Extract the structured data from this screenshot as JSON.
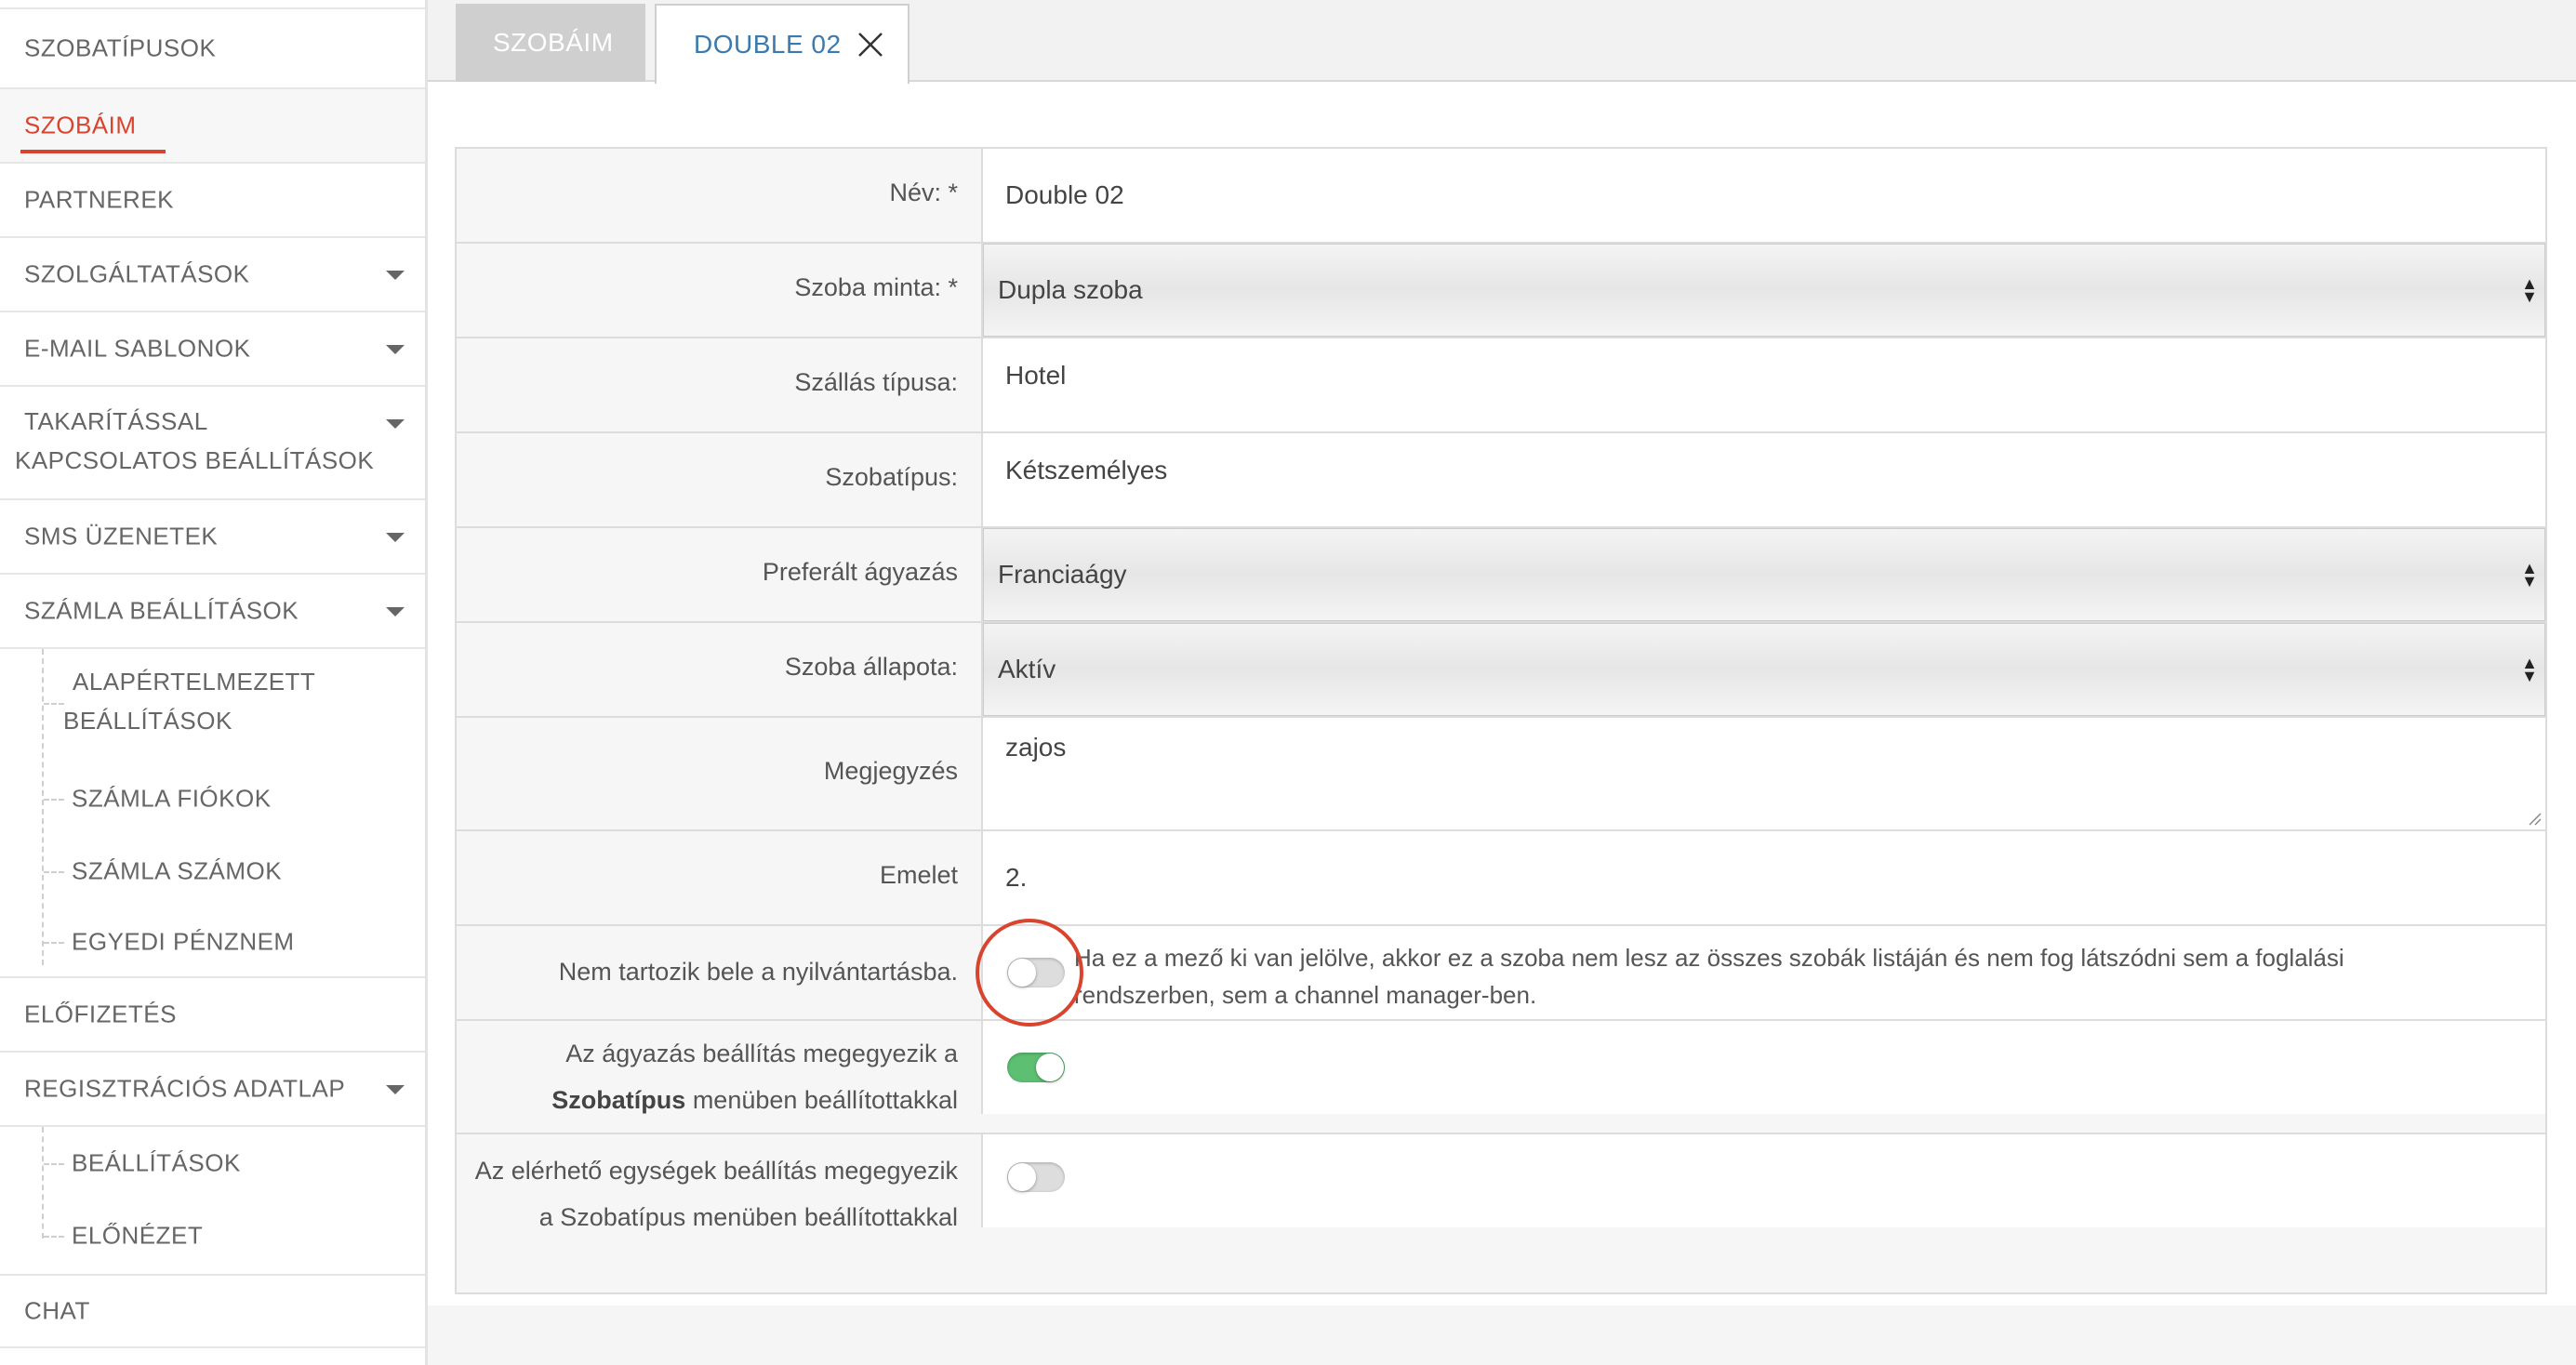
{
  "sidebar": {
    "items": [
      {
        "label": "SZOBATÍPUSOK"
      },
      {
        "label": "SZOBÁIM",
        "active": true
      },
      {
        "label": "PARTNEREK"
      },
      {
        "label": "SZOLGÁLTATÁSOK"
      },
      {
        "label": "E-MAIL SABLONOK"
      },
      {
        "label": "TAKARÍTÁSSAL KAPCSOLATOS BEÁLLÍTÁSOK"
      },
      {
        "label": "SMS ÜZENETEK"
      },
      {
        "label": "SZÁMLA BEÁLLÍTÁSOK"
      }
    ],
    "invoice_sub": [
      {
        "label": "ALAPÉRTELMEZETT BEÁLLÍTÁSOK"
      },
      {
        "label": "SZÁMLA FIÓKOK"
      },
      {
        "label": "SZÁMLA SZÁMOK"
      },
      {
        "label": "EGYEDI PÉNZNEM"
      }
    ],
    "subscription": {
      "label": "ELŐFIZETÉS"
    },
    "registration": {
      "label": "REGISZTRÁCIÓS ADATLAP"
    },
    "registration_sub": [
      {
        "label": "BEÁLLÍTÁSOK"
      },
      {
        "label": "ELŐNÉZET"
      }
    ],
    "chat": {
      "label": "CHAT"
    }
  },
  "tabs": {
    "rooms": "SZOBÁIM",
    "current": "DOUBLE 02",
    "close_icon": "close-icon"
  },
  "form": {
    "name": {
      "label": "Név: *",
      "value": "Double 02"
    },
    "room_template": {
      "label": "Szoba minta: *",
      "value": "Dupla szoba"
    },
    "accommodation_type": {
      "label": "Szállás típusa:",
      "value": "Hotel"
    },
    "room_type": {
      "label": "Szobatípus:",
      "value": "Kétszemélyes"
    },
    "preferred_bedding": {
      "label": "Preferált ágyazás",
      "value": "Franciaágy"
    },
    "room_status": {
      "label": "Szoba állapota:",
      "value": "Aktív"
    },
    "note": {
      "label": "Megjegyzés",
      "value": "zajos"
    },
    "floor": {
      "label": "Emelet",
      "value": "2."
    },
    "not_in_inventory": {
      "label": "Nem tartozik bele a nyilvántartásba.",
      "checked": false,
      "help": "Ha ez a mező ki van jelölve, akkor ez a szoba nem  lesz az összes szobák listáján és nem fog látszódni sem a foglalási rendszerben, sem a channel manager-ben."
    },
    "bedding_matches": {
      "label_pre": "Az ágyazás beállítás megegyezik a",
      "label_bold": "Szobatípus",
      "label_post": "menüben beállítottakkal",
      "checked": true
    },
    "units_match": {
      "label": "Az elérhető egységek beállítás megegyezik a Szobatípus menüben beállítottakkal",
      "checked": false
    }
  },
  "colors": {
    "accent_red": "#d9442f",
    "tab_blue": "#3a7ab0",
    "toggle_on": "#5cbf71"
  }
}
